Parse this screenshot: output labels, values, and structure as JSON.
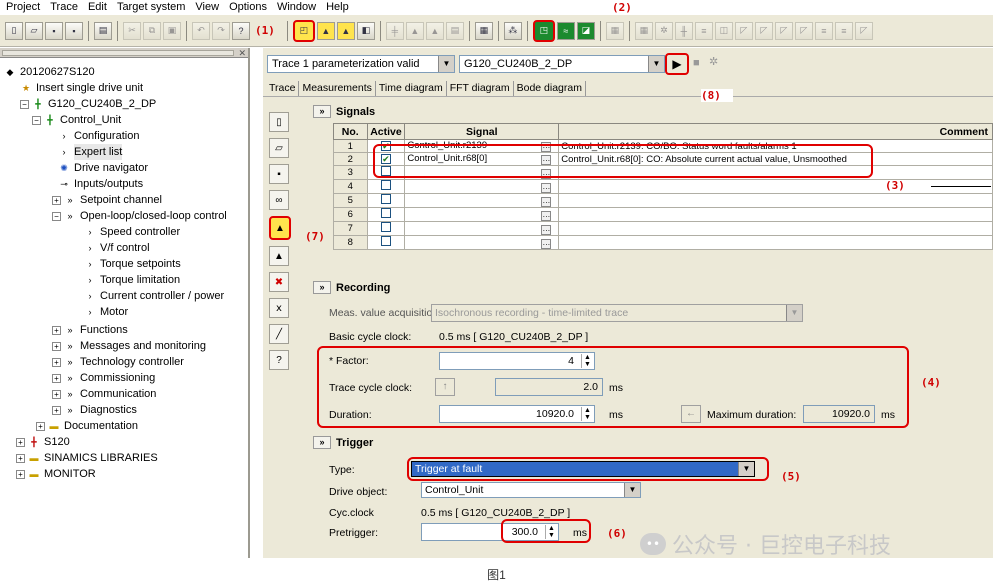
{
  "menu": [
    "Project",
    "Trace",
    "Edit",
    "Target system",
    "View",
    "Options",
    "Window",
    "Help"
  ],
  "annotations": {
    "a1": "(1)",
    "a2": "(2)",
    "a3": "(3)",
    "a4": "(4)",
    "a5": "(5)",
    "a6": "(6)",
    "a7": "(7)",
    "a8": "(8)"
  },
  "tree": {
    "root": "20120627S120",
    "insert": "Insert single drive unit",
    "drive": "G120_CU240B_2_DP",
    "control_unit": "Control_Unit",
    "configuration": "Configuration",
    "expert_list": "Expert list",
    "drive_navigator": "Drive navigator",
    "inputs_outputs": "Inputs/outputs",
    "setpoint_channel": "Setpoint channel",
    "openloop": "Open-loop/closed-loop control",
    "speed_controller": "Speed controller",
    "vf_control": "V/f control",
    "torque_setpoints": "Torque setpoints",
    "torque_limitation": "Torque limitation",
    "current_controller": "Current controller / power",
    "motor": "Motor",
    "functions": "Functions",
    "messages": "Messages and monitoring",
    "technology": "Technology controller",
    "commissioning": "Commissioning",
    "communication": "Communication",
    "diagnostics": "Diagnostics",
    "documentation": "Documentation",
    "s120": "S120",
    "sinamics_libraries": "SINAMICS LIBRARIES",
    "monitor": "MONITOR"
  },
  "trace": {
    "status": "Trace 1 parameterization valid",
    "device": "G120_CU240B_2_DP",
    "tabs": [
      "Trace",
      "Measurements",
      "Time diagram",
      "FFT diagram",
      "Bode diagram"
    ]
  },
  "signals": {
    "heading": "Signals",
    "columns": {
      "no": "No.",
      "active": "Active",
      "signal": "Signal",
      "comment": "Comment"
    },
    "rows": [
      {
        "no": "1",
        "active": true,
        "signal": "Control_Unit.r2139",
        "comment": "Control_Unit.r2139: CO/BO: Status word faults/alarms 1"
      },
      {
        "no": "2",
        "active": true,
        "signal": "Control_Unit.r68[0]",
        "comment": "Control_Unit.r68[0]: CO: Absolute current actual value, Unsmoothed"
      },
      {
        "no": "3",
        "active": false,
        "signal": "",
        "comment": ""
      },
      {
        "no": "4",
        "active": false,
        "signal": "",
        "comment": ""
      },
      {
        "no": "5",
        "active": false,
        "signal": "",
        "comment": ""
      },
      {
        "no": "6",
        "active": false,
        "signal": "",
        "comment": ""
      },
      {
        "no": "7",
        "active": false,
        "signal": "",
        "comment": ""
      },
      {
        "no": "8",
        "active": false,
        "signal": "",
        "comment": ""
      }
    ]
  },
  "recording": {
    "heading": "Recording",
    "acq_label": "Meas. value acquisition:",
    "acq_value": "Isochronous recording - time-limited trace",
    "basic_clock_label": "Basic cycle clock:",
    "basic_clock_value": "0.5 ms   [ G120_CU240B_2_DP ]",
    "factor_label": "* Factor:",
    "factor_value": "4",
    "trace_clock_label": "Trace cycle clock:",
    "trace_clock_value": "2.0",
    "trace_clock_unit": "ms",
    "duration_label": "Duration:",
    "duration_value": "10920.0",
    "duration_unit": "ms",
    "max_duration_label": "Maximum duration:",
    "max_duration_value": "10920.0",
    "max_duration_unit": "ms"
  },
  "trigger": {
    "heading": "Trigger",
    "type_label": "Type:",
    "type_value": "Trigger at fault",
    "drive_label": "Drive object:",
    "drive_value": "Control_Unit",
    "cyc_label": "Cyc.clock",
    "cyc_value": "0.5 ms   [ G120_CU240B_2_DP ]",
    "pretrigger_label": "Pretrigger:",
    "pretrigger_value": "300.0",
    "pretrigger_unit": "ms"
  },
  "watermark": "公众号 · 巨控电子科技",
  "caption": "图1",
  "colors": {
    "highlight": "#e00000",
    "panel": "#ece9d8",
    "selection": "#3169c6"
  }
}
